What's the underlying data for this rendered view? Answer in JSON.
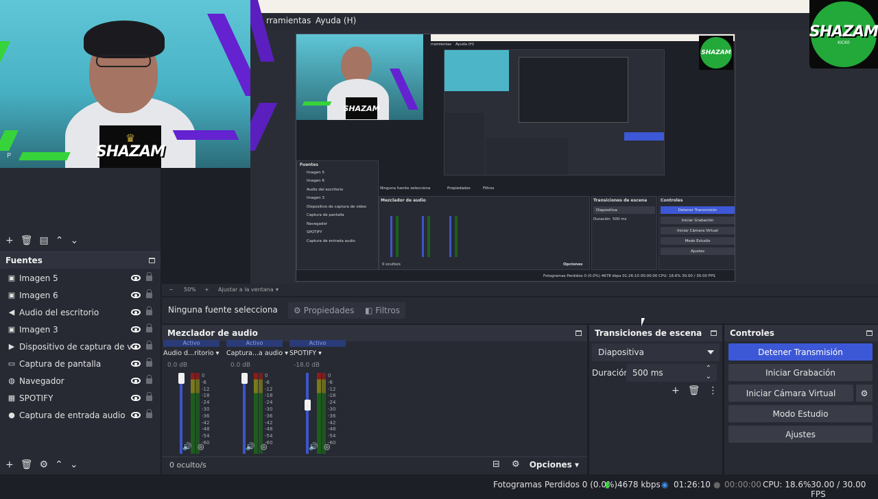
{
  "menubar": {
    "menu_tools": "rramientas",
    "menu_help": "Ayuda (H)"
  },
  "webcam": {
    "logo_text": "SHAZAM",
    "scene_letter": "P"
  },
  "badge": {
    "logo_text": "SHAZAM",
    "sub_text": "KICK0"
  },
  "preview": {
    "menu_tools": "rramientas",
    "menu_help": "Ayuda (H)",
    "fuentes_title": "Fuentes",
    "sources": [
      "Imagen 5",
      "Imagen 6",
      "Audio del escritorio",
      "Imagen 3",
      "Dispositivo de captura de video",
      "Captura de pantalla",
      "Navegador",
      "SPOTIFY",
      "Captura de entrada audio"
    ],
    "nosel": "Ninguna fuente selecciona",
    "props": "Propiedades",
    "filters": "Filtros",
    "mixer_title": "Mezclador de audio",
    "trans_title": "Transiciones de escena",
    "controls_title": "Controles",
    "trans_value": "Diapositiva",
    "dur_label": "Duración",
    "dur_value": "500 ms",
    "btn_stop": "Detener Transmisión",
    "btn_rec": "Iniciar Grabación",
    "btn_vcam": "Iniciar Cámara Virtual",
    "btn_studio": "Modo Estudio",
    "btn_settings": "Ajustes",
    "hidden": "0 oculto/s",
    "options": "Opciones",
    "status": "Fotogramas Perdidos 0 (0.0%)   4678 kbps   01:26:10   00:00:00   CPU: 18.6%   30.00 / 30.00 FPS",
    "zoom": "50%",
    "fit": "Ajustar a la ventana"
  },
  "zoombar": {
    "zoom": "50%",
    "fit": "Ajustar a la ventana"
  },
  "fuentes": {
    "title": "Fuentes",
    "sources": [
      {
        "label": "Imagen 5",
        "icon": "image-icon"
      },
      {
        "label": "Imagen 6",
        "icon": "image-icon"
      },
      {
        "label": "Audio del escritorio",
        "icon": "speaker-icon"
      },
      {
        "label": "Imagen 3",
        "icon": "image-icon"
      },
      {
        "label": "Dispositivo de captura de vídeo",
        "icon": "camera-icon"
      },
      {
        "label": "Captura de pantalla",
        "icon": "monitor-icon"
      },
      {
        "label": "Navegador",
        "icon": "globe-icon"
      },
      {
        "label": "SPOTIFY",
        "icon": "window-icon"
      },
      {
        "label": "Captura de entrada audio",
        "icon": "microphone-icon"
      }
    ]
  },
  "props": {
    "nosel": "Ninguna fuente selecciona",
    "properties": "Propiedades",
    "filters": "Filtros"
  },
  "mixer": {
    "title": "Mezclador de audio",
    "channels": [
      {
        "active": "Activo",
        "name": "Audio d...ritorio",
        "db": "0.0 dB",
        "level": 1.0
      },
      {
        "active": "Activo",
        "name": "Captura...a audio",
        "db": "0.0 dB",
        "level": 1.0
      },
      {
        "active": "Activo",
        "name": "SPOTIFY",
        "db": "-18.0 dB",
        "level": 0.62
      }
    ],
    "scale": [
      "0",
      "-6",
      "-12",
      "-18",
      "-24",
      "-30",
      "-36",
      "-42",
      "-48",
      "-54",
      "-60"
    ],
    "hidden": "0 oculto/s",
    "options": "Opciones"
  },
  "transitions": {
    "title": "Transiciones de escena",
    "value": "Diapositiva",
    "duration_label": "Duración",
    "duration_value": "500 ms"
  },
  "controls": {
    "title": "Controles",
    "stop": "Detener Transmisión",
    "record": "Iniciar Grabación",
    "vcam": "Iniciar Cámara Virtual",
    "studio": "Modo Estudio",
    "settings": "Ajustes"
  },
  "status": {
    "dropped": "Fotogramas Perdidos 0 (0.0%)",
    "kbps": "4678 kbps",
    "live_time": "01:26:10",
    "rec_time": "00:00:00",
    "cpu": "CPU: 18.6%",
    "fps": "30.00 / 30.00 FPS"
  },
  "colors": {
    "accent": "#3d58d6",
    "bg": "#272a33",
    "green": "#36d33b",
    "purple": "#6422d0"
  }
}
